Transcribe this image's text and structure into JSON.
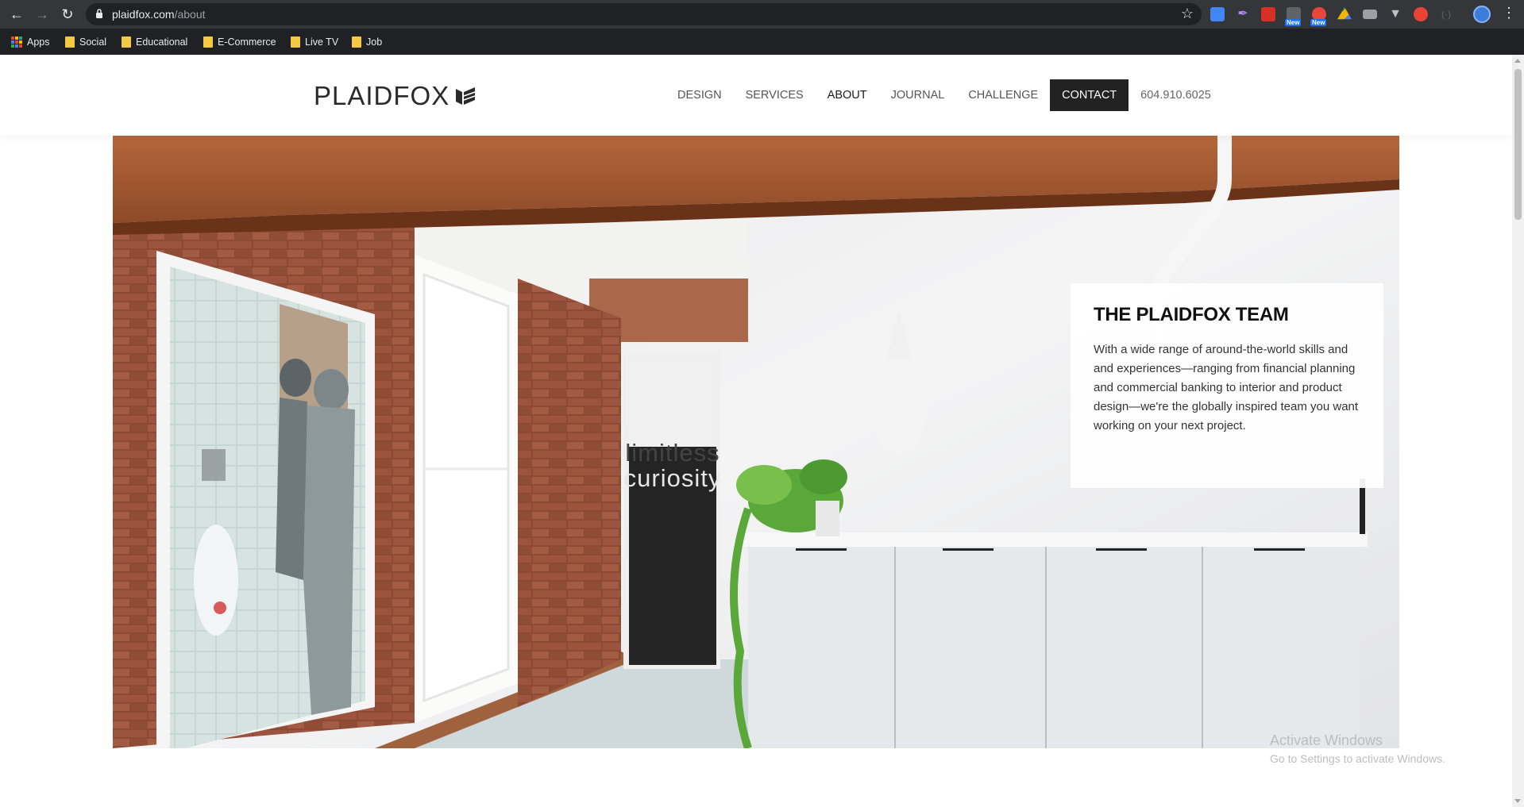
{
  "browser": {
    "url_domain": "plaidfox.com",
    "url_path": "/about",
    "bookmarks": [
      {
        "label": "Apps"
      },
      {
        "label": "Social"
      },
      {
        "label": "Educational"
      },
      {
        "label": "E-Commerce"
      },
      {
        "label": "Live TV"
      },
      {
        "label": "Job"
      }
    ],
    "extension_badge": "New"
  },
  "site": {
    "logo_text": "PLAIDFOX",
    "nav": {
      "design": "DESIGN",
      "services": "SERVICES",
      "about": "ABOUT",
      "journal": "JOURNAL",
      "challenge": "CHALLENGE",
      "contact": "CONTACT",
      "phone": "604.910.6025"
    },
    "hero": {
      "door_text_line1": "limitless",
      "door_text_line2": "curiosity"
    },
    "card": {
      "title": "THE PLAIDFOX TEAM",
      "body": "With a wide range of around-the-world skills and and experiences—ranging from financial planning and commercial banking to interior and product design—we're the globally inspired team you want working on your next project."
    }
  },
  "watermark": {
    "line1": "Activate Windows",
    "line2": "Go to Settings to activate Windows."
  },
  "colors": {
    "chrome_dark": "#202124",
    "contact_bg": "#222222",
    "folder": "#f6c945"
  }
}
